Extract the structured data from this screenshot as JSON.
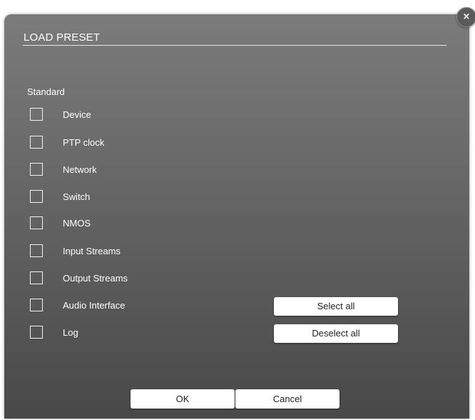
{
  "dialog": {
    "title": "LOAD PRESET",
    "close_icon": "close-icon",
    "close_glyph": "×"
  },
  "section": {
    "label": "Standard"
  },
  "options": [
    {
      "label": "Device",
      "checked": false
    },
    {
      "label": "PTP clock",
      "checked": false
    },
    {
      "label": "Network",
      "checked": false
    },
    {
      "label": "Switch",
      "checked": false
    },
    {
      "label": "NMOS",
      "checked": false
    },
    {
      "label": "Input Streams",
      "checked": false
    },
    {
      "label": "Output Streams",
      "checked": false
    },
    {
      "label": "Audio Interface",
      "checked": false
    },
    {
      "label": "Log",
      "checked": false
    }
  ],
  "buttons": {
    "select_all": "Select all",
    "deselect_all": "Deselect all",
    "ok": "OK",
    "cancel": "Cancel"
  },
  "colors": {
    "dialog_top": "#7b7b7b",
    "dialog_bottom": "#484848",
    "text": "#ffffff",
    "button_bg": "#ffffff",
    "button_text": "#222222"
  }
}
